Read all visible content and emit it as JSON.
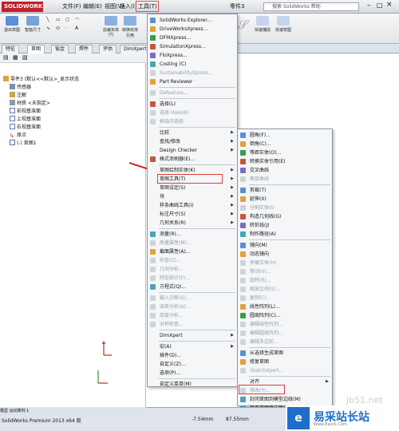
{
  "titlebar": {
    "logo": "SOLIDWORKS",
    "menus": [
      "文件(F)",
      "编辑(E)",
      "视图(V)",
      "插入(I)",
      "工具(T)"
    ],
    "parts_label": "零件3",
    "search_placeholder": "搜索 SolidWorks 帮助"
  },
  "ribbon": {
    "buttons": [
      "退出草图",
      "智能尺寸",
      "剪裁实体(T)",
      "转换实体引用",
      "快速捕捉",
      "快速草图"
    ]
  },
  "tabs": [
    "特征",
    "草图",
    "钣金",
    "焊件",
    "评估",
    "DimXpert"
  ],
  "tree": {
    "items": [
      "零件3 (默认<<默认>_显示状态",
      "传感器",
      "注解",
      "材质 <未指定>",
      "前视基准面",
      "上视基准面",
      "右视基准面",
      "原点",
      "(-) 草图1"
    ]
  },
  "menu1": {
    "items": [
      {
        "label": "SolidWorks Explorer...",
        "disabled": false,
        "arrow": false
      },
      {
        "label": "DriveWorksXpress...",
        "disabled": false,
        "arrow": false
      },
      {
        "label": "DFMXpress...",
        "disabled": false,
        "arrow": false
      },
      {
        "label": "SimulationXpress...",
        "disabled": false,
        "arrow": false
      },
      {
        "label": "FloXpress...",
        "disabled": false,
        "arrow": false
      },
      {
        "label": "Costing (C)",
        "disabled": false,
        "arrow": false
      },
      {
        "label": "SustainabilityXpress...",
        "disabled": true,
        "arrow": false
      },
      {
        "label": "Part Reviewer",
        "disabled": false,
        "arrow": false
      },
      {
        "label": "Defeature...",
        "disabled": true,
        "arrow": false
      },
      {
        "label": "选择(L)",
        "disabled": false,
        "arrow": false
      },
      {
        "label": "选择 Halo(B)",
        "disabled": true,
        "arrow": false
      },
      {
        "label": "框选中选择",
        "disabled": true,
        "arrow": false
      },
      {
        "label": "比较",
        "disabled": false,
        "arrow": true
      },
      {
        "label": "查找/修改",
        "disabled": false,
        "arrow": true
      },
      {
        "label": "Design Checker",
        "disabled": false,
        "arrow": true
      },
      {
        "label": "格式涂刷器(E)...",
        "disabled": false,
        "arrow": false
      },
      {
        "label": "草图绘制实体(K)",
        "disabled": false,
        "arrow": true
      },
      {
        "label": "草图工具(T)",
        "disabled": false,
        "arrow": true
      },
      {
        "label": "草图设定(S)",
        "disabled": false,
        "arrow": true
      },
      {
        "label": "块",
        "disabled": false,
        "arrow": true
      },
      {
        "label": "样条曲线工具(I)",
        "disabled": false,
        "arrow": true
      },
      {
        "label": "标注尺寸(S)",
        "disabled": false,
        "arrow": true
      },
      {
        "label": "几何关系(R)",
        "disabled": false,
        "arrow": true
      },
      {
        "label": "测量(R)...",
        "disabled": false,
        "arrow": false
      },
      {
        "label": "质量属性(M)...",
        "disabled": true,
        "arrow": false
      },
      {
        "label": "截面属性(A)...",
        "disabled": false,
        "arrow": false
      },
      {
        "label": "检查(C)...",
        "disabled": true,
        "arrow": false
      },
      {
        "label": "几何分析...",
        "disabled": true,
        "arrow": false
      },
      {
        "label": "特征统计(F)...",
        "disabled": true,
        "arrow": false
      },
      {
        "label": "方程式(Q)...",
        "disabled": false,
        "arrow": false
      },
      {
        "label": "输入诊断(G)...",
        "disabled": true,
        "arrow": false
      },
      {
        "label": "误差分析(A)...",
        "disabled": true,
        "arrow": false
      },
      {
        "label": "厚度分析...",
        "disabled": true,
        "arrow": false
      },
      {
        "label": "对称检查...",
        "disabled": true,
        "arrow": false
      },
      {
        "label": "DimXpert",
        "disabled": false,
        "arrow": true
      },
      {
        "label": "宏(A)",
        "disabled": false,
        "arrow": true
      },
      {
        "label": "插件(D)...",
        "disabled": false,
        "arrow": false
      },
      {
        "label": "自定义(Z)...",
        "disabled": false,
        "arrow": false
      },
      {
        "label": "选项(P)...",
        "disabled": false,
        "arrow": false
      },
      {
        "label": "自定义菜单(M)",
        "disabled": false,
        "arrow": false
      }
    ]
  },
  "menu2": {
    "items": [
      {
        "label": "圆角(F)...",
        "disabled": false,
        "arrow": false
      },
      {
        "label": "倒角(C)...",
        "disabled": false,
        "arrow": false
      },
      {
        "label": "等距实体(O)...",
        "disabled": false,
        "arrow": false
      },
      {
        "label": "转换实体引用(E)",
        "disabled": false,
        "arrow": false
      },
      {
        "label": "交叉曲线",
        "disabled": false,
        "arrow": false
      },
      {
        "label": "面部曲线",
        "disabled": true,
        "arrow": false
      },
      {
        "label": "剪裁(T)",
        "disabled": false,
        "arrow": false
      },
      {
        "label": "延伸(X)",
        "disabled": false,
        "arrow": false
      },
      {
        "label": "分割实体(I)",
        "disabled": true,
        "arrow": false
      },
      {
        "label": "构造几何线(G)",
        "disabled": false,
        "arrow": false
      },
      {
        "label": "转折线(J)",
        "disabled": false,
        "arrow": false
      },
      {
        "label": "制作路径(A)",
        "disabled": false,
        "arrow": false
      },
      {
        "label": "镜向(M)",
        "disabled": false,
        "arrow": false
      },
      {
        "label": "动态镜向",
        "disabled": false,
        "arrow": false
      },
      {
        "label": "伸展实体(H)",
        "disabled": true,
        "arrow": false
      },
      {
        "label": "移动(V)...",
        "disabled": true,
        "arrow": false
      },
      {
        "label": "旋转(R)...",
        "disabled": true,
        "arrow": false
      },
      {
        "label": "缩放比例(S)...",
        "disabled": true,
        "arrow": false
      },
      {
        "label": "复制(C)...",
        "disabled": true,
        "arrow": false
      },
      {
        "label": "线性阵列(L)...",
        "disabled": false,
        "arrow": false
      },
      {
        "label": "圆周阵列(C)...",
        "disabled": false,
        "arrow": false
      },
      {
        "label": "编辑线性阵列...",
        "disabled": true,
        "arrow": false
      },
      {
        "label": "编辑圆周阵列...",
        "disabled": true,
        "arrow": false
      },
      {
        "label": "编辑多边形...",
        "disabled": true,
        "arrow": false
      },
      {
        "label": "从选择生成草图",
        "disabled": false,
        "arrow": false
      },
      {
        "label": "修复草图",
        "disabled": false,
        "arrow": false
      },
      {
        "label": "SketchXpert...",
        "disabled": true,
        "arrow": false
      },
      {
        "label": "对齐",
        "disabled": false,
        "arrow": true
      },
      {
        "label": "修改(Y)...",
        "disabled": true,
        "arrow": false
      },
      {
        "label": "封闭草图到模型边线(M)",
        "disabled": false,
        "arrow": false
      },
      {
        "label": "检查草图合法性(K)",
        "disabled": false,
        "arrow": false
      },
      {
        "label": "2D 到 3D",
        "disabled": false,
        "arrow": true
      },
      {
        "label": "草图图片(P)...",
        "disabled": false,
        "arrow": false
      },
      {
        "label": "区域剖面线/填充",
        "disabled": false,
        "arrow": false
      }
    ]
  },
  "statusbar": {
    "model_tabs": "模型  运动算例 1",
    "status": "SolidWorks Premium 2013 x64 版",
    "coord_x": "-7.54mm",
    "coord_y": "87.55mm"
  },
  "watermark": {
    "logo": "e",
    "text": "易采站长站",
    "site": "Www.Easck.Com",
    "url": "jb51.net"
  },
  "colors": {
    "accent": "#e03a3a",
    "brand": "#1d6ec9",
    "arrow": "#d62828"
  }
}
